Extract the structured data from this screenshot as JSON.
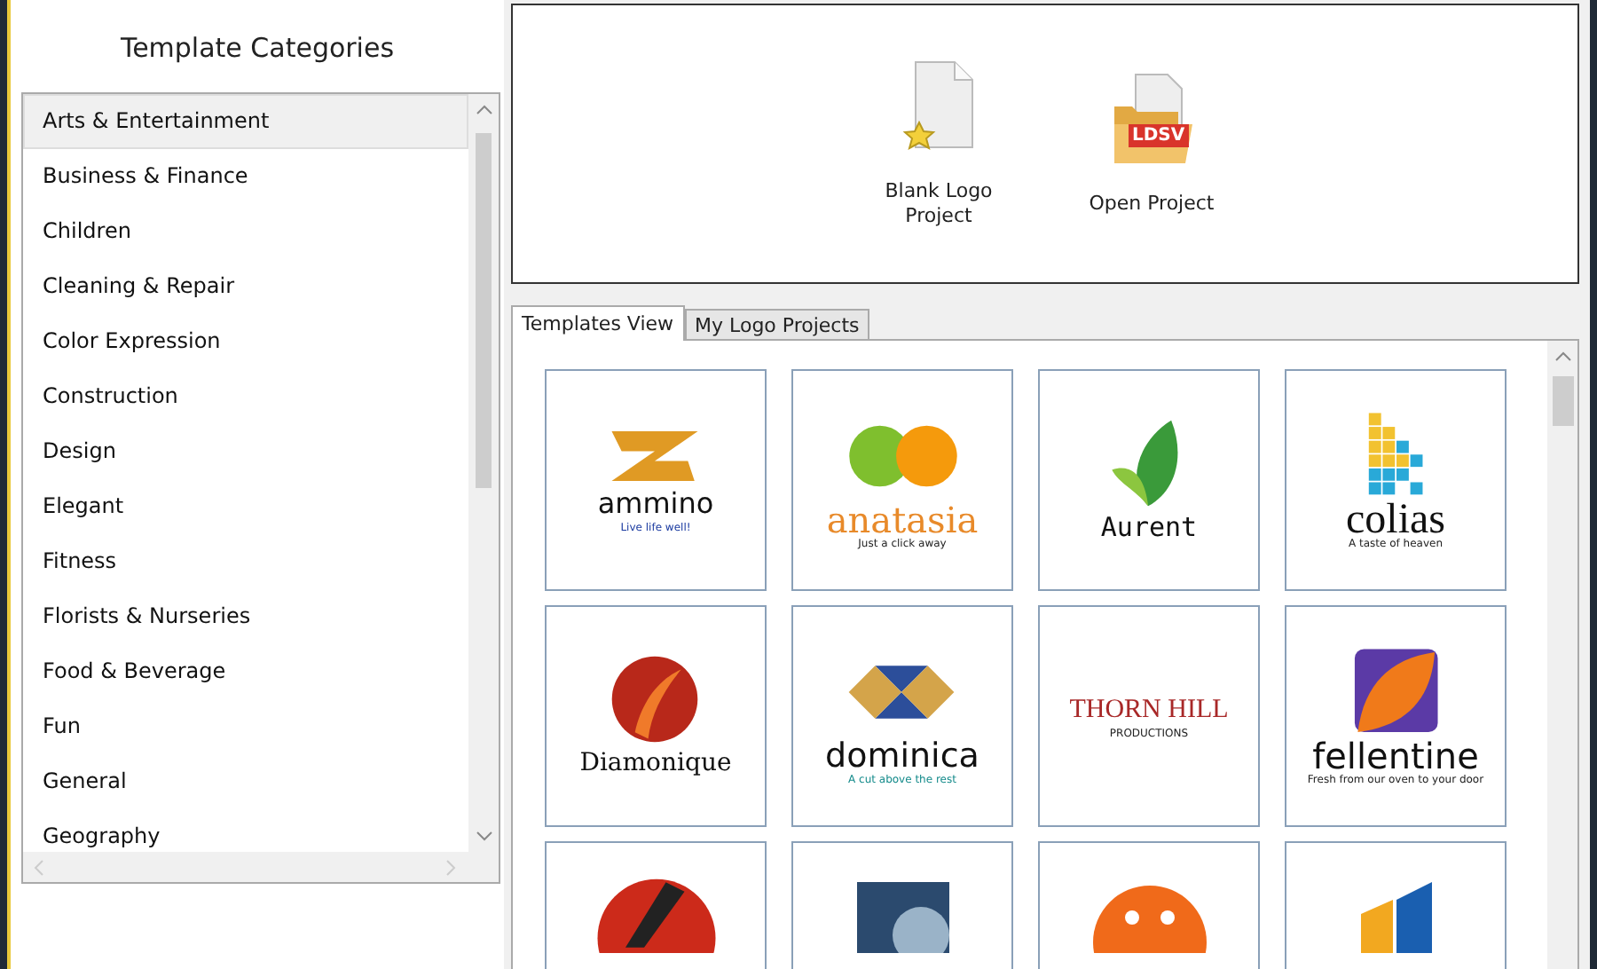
{
  "sidebar": {
    "title": "Template Categories",
    "items": [
      {
        "label": "Arts & Entertainment",
        "selected": true
      },
      {
        "label": "Business & Finance",
        "selected": false
      },
      {
        "label": "Children",
        "selected": false
      },
      {
        "label": "Cleaning & Repair",
        "selected": false
      },
      {
        "label": "Color Expression",
        "selected": false
      },
      {
        "label": "Construction",
        "selected": false
      },
      {
        "label": "Design",
        "selected": false
      },
      {
        "label": "Elegant",
        "selected": false
      },
      {
        "label": "Fitness",
        "selected": false
      },
      {
        "label": "Florists & Nurseries",
        "selected": false
      },
      {
        "label": "Food & Beverage",
        "selected": false
      },
      {
        "label": "Fun",
        "selected": false
      },
      {
        "label": "General",
        "selected": false
      },
      {
        "label": "Geography",
        "selected": false
      }
    ]
  },
  "actions": [
    {
      "kind": "blank",
      "label": "Blank Logo Project"
    },
    {
      "kind": "open",
      "label": "Open Project",
      "badge": "LDSV"
    }
  ],
  "tabs": [
    {
      "label": "Templates View",
      "selected": true
    },
    {
      "label": "My Logo Projects",
      "selected": false
    }
  ],
  "templates": [
    {
      "kind": "ammino",
      "name": "ammino",
      "tagline": "Live life well!"
    },
    {
      "kind": "anatasia",
      "name": "anatasia",
      "tagline": "Just a click away"
    },
    {
      "kind": "aurent",
      "name": "Aurent"
    },
    {
      "kind": "colias",
      "name": "colias",
      "tagline": "A taste of heaven"
    },
    {
      "kind": "diamonique",
      "name": "Diamonique"
    },
    {
      "kind": "dominica",
      "name": "dominica",
      "tagline": "A cut above the rest"
    },
    {
      "kind": "thornhill",
      "name": "THORN HILL",
      "tagline": "PRODUCTIONS"
    },
    {
      "kind": "fellentine",
      "name": "fellentine",
      "tagline": "Fresh from our oven to your door"
    },
    {
      "kind": "film"
    },
    {
      "kind": "planet"
    },
    {
      "kind": "reel"
    },
    {
      "kind": "kblock"
    }
  ]
}
